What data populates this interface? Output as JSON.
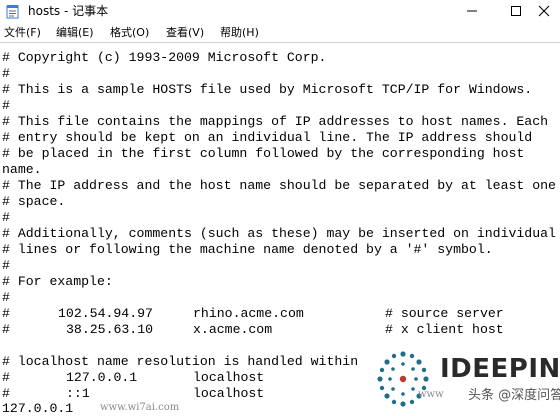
{
  "window": {
    "title": "hosts - 记事本",
    "icon": "notepad-icon",
    "controls": {
      "minimize_icon": "minimize-icon",
      "maximize_icon": "maximize-icon",
      "close_icon": "close-icon"
    }
  },
  "menu": {
    "file": "文件(F)",
    "edit": "编辑(E)",
    "format": "格式(O)",
    "view": "查看(V)",
    "help": "帮助(H)"
  },
  "content": {
    "lines": [
      "# Copyright (c) 1993-2009 Microsoft Corp.",
      "#",
      "# This is a sample HOSTS file used by Microsoft TCP/IP for Windows.",
      "#",
      "# This file contains the mappings of IP addresses to host names. Each",
      "# entry should be kept on an individual line. The IP address should",
      "# be placed in the first column followed by the corresponding host",
      "name.",
      "# The IP address and the host name should be separated by at least one",
      "# space.",
      "#",
      "# Additionally, comments (such as these) may be inserted on individual",
      "# lines or following the machine name denoted by a '#' symbol.",
      "#",
      "# For example:",
      "#",
      "",
      "",
      "",
      "# localhost name resolution is handled within"
    ],
    "example_rows": [
      {
        "hash": "#",
        "ip": "102.54.94.97",
        "host": "rhino.acme.com",
        "comment": "# source server"
      },
      {
        "hash": "#",
        "ip": "38.25.63.10",
        "host": "x.acme.com",
        "comment": "# x client host"
      }
    ],
    "localhost_rows": [
      {
        "hash": "#",
        "ip": "127.0.0.1",
        "host": "localhost"
      },
      {
        "hash": "#",
        "ip": "::1",
        "host": "localhost"
      }
    ],
    "last_line_ip": "127.0.0.1"
  },
  "watermark": {
    "brand": "IDEEPIN",
    "sub": "头条 @深度问答",
    "site": "www.wi7ai.com",
    "site2": "www"
  },
  "colors": {
    "title_bg": "#ffffff",
    "editor_bg": "#ffffff",
    "logo_teal": "#1f6f8b",
    "logo_red": "#c0392b"
  }
}
